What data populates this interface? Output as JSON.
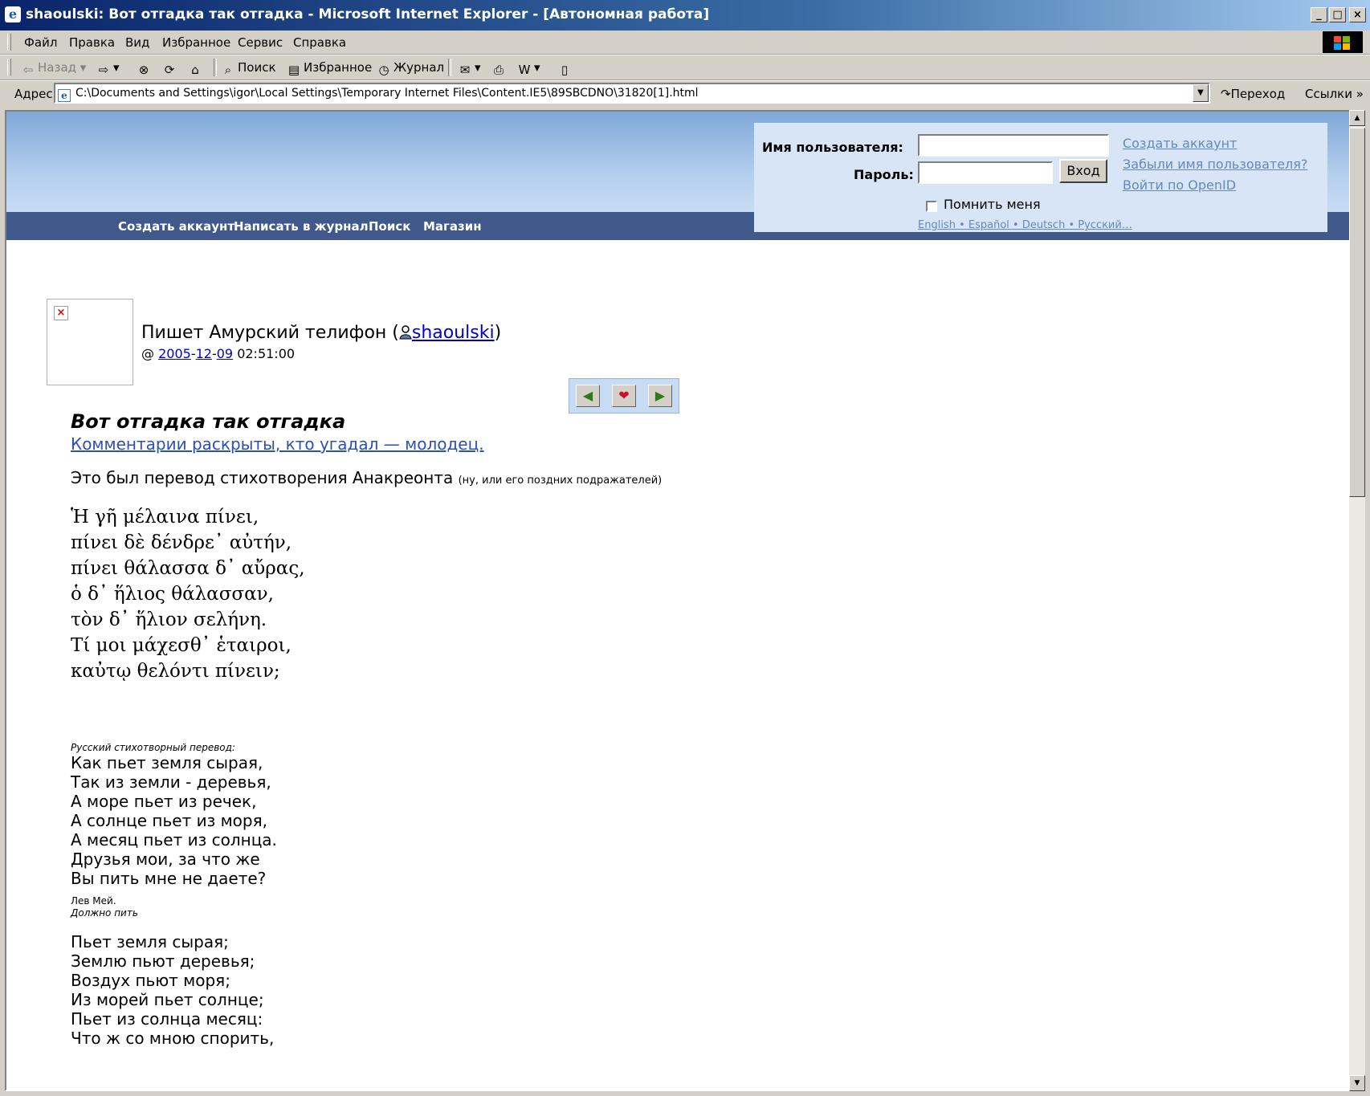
{
  "window": {
    "title": "shaoulski: Вот отгадка так отгадка - Microsoft Internet Explorer - [Автономная работа]",
    "controls": {
      "minimize": "_",
      "maximize": "□",
      "close": "×"
    }
  },
  "menu": [
    "Файл",
    "Правка",
    "Вид",
    "Избранное",
    "Сервис",
    "Справка"
  ],
  "toolbar": {
    "back": "Назад",
    "search": "Поиск",
    "favorites": "Избранное",
    "history": "Журнал"
  },
  "address": {
    "label": "Адрес",
    "url": "C:\\Documents and Settings\\igor\\Local Settings\\Temporary Internet Files\\Content.IE5\\89SBCDNO\\31820[1].html",
    "go": "Переход",
    "links": "Ссылки"
  },
  "site": {
    "nav": [
      "Создать аккаунт",
      "Написать в журнал",
      "Поиск",
      "Магазин"
    ],
    "login": {
      "username_label": "Имя пользователя:",
      "password_label": "Пароль:",
      "submit": "Вход",
      "remember": "Помнить меня",
      "links": [
        "Создать аккаунт",
        "Забыли имя пользователя?",
        "Войти по OpenID"
      ],
      "languages": "English • Español • Deutsch • Русский…"
    },
    "colors": {
      "nav_bg": "#41598a",
      "login_bg": "#d7e5f7",
      "link": "#6688bb"
    }
  },
  "entry": {
    "poster_prefix": "Пишет Амурский телифон (",
    "username": "shaoulski",
    "poster_suffix": ")",
    "date_prefix": "@ ",
    "year": "2005",
    "month": "12",
    "day": "09",
    "time": "02:51:00",
    "subject": "Вот отгадка так отгадка",
    "subject_link": "Комментарии раскрыты, кто угадал — молодец.",
    "intro": "Это был перевод стихотворения Анакреонта ",
    "intro_small": "(ну, или его поздних подражателей)",
    "greek": [
      "Ἡ γῆ μέλαινα πίνει,",
      "πίνει δὲ δένδρε᾽ αὐτήν,",
      "πίνει θάλασσα δ᾽ αὔρας,",
      "ὁ δ᾽ ἥλιος θάλασσαν,",
      "τὸν δ᾽ ἥλιον σελήνη.",
      "Τί μοι μάχεσθ᾽ ἑταιροι,",
      "καὐτῳ θελόντι πίνειν;"
    ],
    "translation_label": "Русский стихотворный перевод:",
    "translation1": [
      "Как пьет земля сырая,",
      "Так из земли - деревья,",
      "А море пьет из речек,",
      "А солнце пьет из моря,",
      "А месяц пьет из солнца.",
      "Друзья мои, за что же",
      "Вы пить мне не даете?"
    ],
    "author": "Лев Мей.",
    "poem_title": "Должно пить",
    "translation2": [
      "Пьет земля сырая;",
      "Землю пьют деревья;",
      "Воздух пьют моря;",
      "Из морей пьет солнце;",
      "Пьет из солнца месяц:",
      "Что ж со мною спорить,"
    ]
  }
}
